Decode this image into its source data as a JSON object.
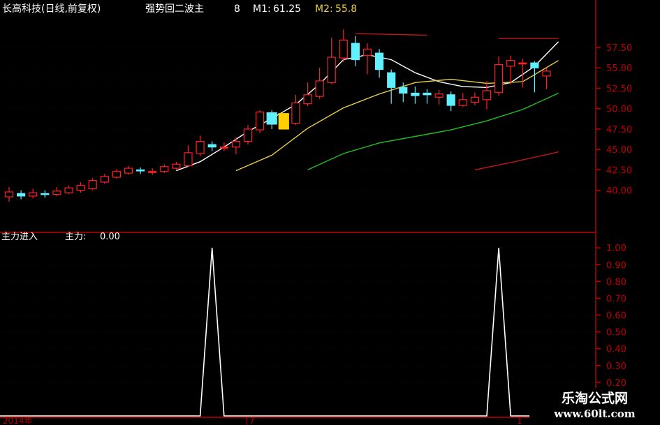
{
  "header": {
    "title": "长高科技(日线,前复权)",
    "indicator": "强势回二波主",
    "indicator_param": "8",
    "m1_label": "M1:",
    "m1_value": "61.25",
    "m2_label": "M2:",
    "m2_value": "55.8"
  },
  "sub_header": {
    "label": "主力进入",
    "value_label": "主力:",
    "value": "0.00"
  },
  "time_axis": {
    "year_label": "2014年",
    "month_label": "7",
    "end_label": "1"
  },
  "watermark": {
    "name": "乐淘公式网",
    "url": "www.60lt.com"
  },
  "colors": {
    "background": "#000000",
    "up_candle": "#ff2020",
    "down_candle": "#60f0ff",
    "limit_up_candle": "#ffd000",
    "ma_short": "#ffffff",
    "ma_mid": "#e8d048",
    "ma_long": "#20c020",
    "ma_longer": "#c01818",
    "axis": "#c00000",
    "indicator_line": "#ffffff"
  },
  "chart_data": [
    {
      "type": "candlestick",
      "title": "长高科技(日线,前复权)",
      "y_ticks": [
        40.0,
        42.5,
        45.0,
        47.5,
        50.0,
        52.5,
        55.0,
        57.5
      ],
      "y_tick_labels": [
        "40.00",
        "42.50",
        "45.00",
        "47.50",
        "50.00",
        "52.50",
        "55.00",
        "57.50"
      ],
      "ylim": [
        35.1,
        61.6
      ],
      "candles": [
        {
          "o": 39.2,
          "c": 39.8,
          "h": 40.4,
          "l": 38.6
        },
        {
          "o": 39.6,
          "c": 39.3,
          "h": 40.0,
          "l": 38.9
        },
        {
          "o": 39.3,
          "c": 39.7,
          "h": 40.2,
          "l": 39.0
        },
        {
          "o": 39.6,
          "c": 39.5,
          "h": 40.0,
          "l": 39.1
        },
        {
          "o": 39.5,
          "c": 39.9,
          "h": 40.4,
          "l": 39.3
        },
        {
          "o": 39.7,
          "c": 40.3,
          "h": 40.6,
          "l": 39.5
        },
        {
          "o": 40.0,
          "c": 40.6,
          "h": 41.0,
          "l": 39.7
        },
        {
          "o": 40.2,
          "c": 41.2,
          "h": 41.5,
          "l": 40.0
        },
        {
          "o": 41.0,
          "c": 41.7,
          "h": 42.0,
          "l": 40.8
        },
        {
          "o": 41.6,
          "c": 42.3,
          "h": 42.6,
          "l": 41.4
        },
        {
          "o": 42.1,
          "c": 42.7,
          "h": 43.0,
          "l": 41.9
        },
        {
          "o": 42.5,
          "c": 42.4,
          "h": 42.8,
          "l": 42.0
        },
        {
          "o": 42.3,
          "c": 42.3,
          "h": 42.7,
          "l": 41.9
        },
        {
          "o": 42.3,
          "c": 42.9,
          "h": 43.2,
          "l": 42.1
        },
        {
          "o": 42.7,
          "c": 43.2,
          "h": 43.5,
          "l": 42.5
        },
        {
          "o": 43.0,
          "c": 44.6,
          "h": 45.5,
          "l": 42.9
        },
        {
          "o": 44.5,
          "c": 46.0,
          "h": 46.7,
          "l": 44.2
        },
        {
          "o": 45.6,
          "c": 45.3,
          "h": 46.0,
          "l": 44.8
        },
        {
          "o": 45.3,
          "c": 45.3,
          "h": 45.9,
          "l": 44.8
        },
        {
          "o": 45.3,
          "c": 46.0,
          "h": 46.5,
          "l": 44.4
        },
        {
          "o": 46.0,
          "c": 47.5,
          "h": 48.0,
          "l": 45.6
        },
        {
          "o": 47.4,
          "c": 49.6,
          "h": 49.8,
          "l": 47.0
        },
        {
          "o": 49.5,
          "c": 48.1,
          "h": 49.8,
          "l": 47.5,
          "color": "down"
        },
        {
          "o": 49.4,
          "c": 47.5,
          "h": 49.4,
          "l": 47.5,
          "color": "limit"
        },
        {
          "o": 48.2,
          "c": 50.7,
          "h": 51.7,
          "l": 48.0
        },
        {
          "o": 50.6,
          "c": 51.7,
          "h": 53.2,
          "l": 50.3
        },
        {
          "o": 51.5,
          "c": 53.4,
          "h": 55.0,
          "l": 51.2
        },
        {
          "o": 53.2,
          "c": 56.3,
          "h": 58.7,
          "l": 53.0
        },
        {
          "o": 56.2,
          "c": 58.4,
          "h": 59.7,
          "l": 55.7
        },
        {
          "o": 58.0,
          "c": 56.0,
          "h": 58.9,
          "l": 55.2
        },
        {
          "o": 56.5,
          "c": 57.3,
          "h": 58.0,
          "l": 54.2
        },
        {
          "o": 56.8,
          "c": 54.8,
          "h": 57.3,
          "l": 53.8
        },
        {
          "o": 54.4,
          "c": 52.6,
          "h": 54.8,
          "l": 50.6
        },
        {
          "o": 52.6,
          "c": 51.9,
          "h": 53.2,
          "l": 50.8
        },
        {
          "o": 51.9,
          "c": 51.6,
          "h": 52.7,
          "l": 50.6
        },
        {
          "o": 51.9,
          "c": 51.7,
          "h": 52.4,
          "l": 50.6
        },
        {
          "o": 51.4,
          "c": 51.8,
          "h": 52.3,
          "l": 50.5
        },
        {
          "o": 51.7,
          "c": 50.4,
          "h": 52.1,
          "l": 49.7
        },
        {
          "o": 50.4,
          "c": 51.1,
          "h": 51.9,
          "l": 50.2
        },
        {
          "o": 50.8,
          "c": 51.4,
          "h": 52.0,
          "l": 50.4
        },
        {
          "o": 51.1,
          "c": 52.2,
          "h": 53.4,
          "l": 49.9
        },
        {
          "o": 52.0,
          "c": 55.4,
          "h": 56.4,
          "l": 51.6
        },
        {
          "o": 55.2,
          "c": 55.9,
          "h": 56.5,
          "l": 53.0
        },
        {
          "o": 55.6,
          "c": 55.6,
          "h": 56.1,
          "l": 52.6
        },
        {
          "o": 55.6,
          "c": 55.0,
          "h": 55.8,
          "l": 52.0
        },
        {
          "o": 54.0,
          "c": 54.6,
          "h": 55.0,
          "l": 52.4
        }
      ],
      "moving_averages": [
        {
          "name": "MA-white",
          "color": "ma_short",
          "points": [
            [
              14,
              42.4
            ],
            [
              16,
              43.5
            ],
            [
              18,
              45.3
            ],
            [
              20,
              47.2
            ],
            [
              22,
              48.8
            ],
            [
              24,
              50.5
            ],
            [
              26,
              53.0
            ],
            [
              28,
              56.0
            ],
            [
              30,
              56.6
            ],
            [
              32,
              56.0
            ],
            [
              34,
              54.4
            ],
            [
              36,
              53.3
            ],
            [
              38,
              52.7
            ],
            [
              40,
              52.6
            ],
            [
              42,
              53.2
            ],
            [
              44,
              55.2
            ],
            [
              46,
              58.2
            ]
          ]
        },
        {
          "name": "MA-yellow",
          "color": "ma_mid",
          "points": [
            [
              19,
              42.4
            ],
            [
              22,
              44.3
            ],
            [
              25,
              47.6
            ],
            [
              28,
              50.1
            ],
            [
              31,
              51.8
            ],
            [
              34,
              53.2
            ],
            [
              37,
              53.6
            ],
            [
              40,
              53.1
            ],
            [
              43,
              53.3
            ],
            [
              46,
              55.9
            ]
          ]
        },
        {
          "name": "MA-green",
          "color": "ma_long",
          "points": [
            [
              25,
              42.5
            ],
            [
              28,
              44.5
            ],
            [
              31,
              45.8
            ],
            [
              34,
              46.6
            ],
            [
              37,
              47.4
            ],
            [
              40,
              48.5
            ],
            [
              43,
              49.9
            ],
            [
              46,
              51.9
            ]
          ]
        },
        {
          "name": "MA-red",
          "color": "ma_longer",
          "points": [
            [
              39,
              42.5
            ],
            [
              42,
              43.4
            ],
            [
              46,
              44.7
            ]
          ]
        }
      ],
      "resistance_lines": [
        {
          "from": [
            29,
            59.2
          ],
          "to": [
            35,
            59.0
          ]
        },
        {
          "from": [
            41,
            58.6
          ],
          "to": [
            46,
            58.6
          ]
        }
      ]
    },
    {
      "type": "line",
      "title": "主力进入",
      "y_tick_labels": [
        "0.20",
        "0.30",
        "0.40",
        "0.50",
        "0.60",
        "0.70",
        "0.80",
        "0.90",
        "1.00"
      ],
      "y_ticks": [
        0.2,
        0.3,
        0.4,
        0.5,
        0.6,
        0.7,
        0.8,
        0.9,
        1.0
      ],
      "ylim": [
        0.0,
        1.03
      ],
      "series": [
        {
          "x": [
            0,
            16,
            17,
            18,
            40,
            41,
            42,
            46
          ],
          "values": [
            0,
            0,
            1,
            0,
            0,
            1,
            0,
            0
          ]
        }
      ]
    }
  ]
}
